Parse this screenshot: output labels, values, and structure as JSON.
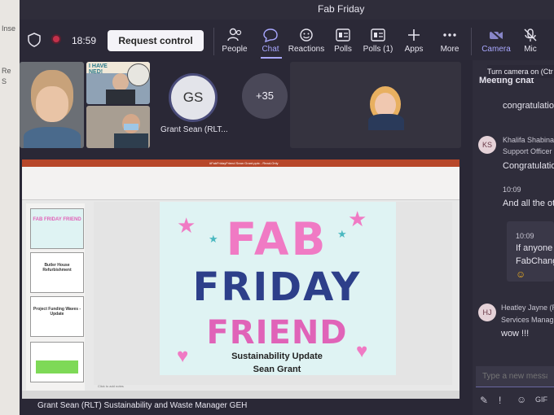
{
  "window": {
    "title": "Fab Friday"
  },
  "background_app": {
    "fragments": [
      "Inse",
      "Re",
      "S"
    ]
  },
  "toolbar": {
    "timer": "18:59",
    "request_control": "Request control",
    "buttons": [
      {
        "label": "People",
        "icon": "people-icon"
      },
      {
        "label": "Chat",
        "icon": "chat-icon"
      },
      {
        "label": "Reactions",
        "icon": "reactions-icon"
      },
      {
        "label": "Polls",
        "icon": "polls-icon"
      },
      {
        "label": "Polls (1)",
        "icon": "polls-icon"
      },
      {
        "label": "Apps",
        "icon": "plus-icon"
      },
      {
        "label": "More",
        "icon": "more-icon"
      },
      {
        "label": "Camera",
        "icon": "camera-off-icon"
      },
      {
        "label": "Mic",
        "icon": "mic-off-icon"
      }
    ],
    "tooltip": "Turn camera on (Ctr"
  },
  "participants": {
    "avatar_initials": "GS",
    "avatar_name": "Grant Sean (RLT...",
    "overflow_count": "+35",
    "tile_text": "I HAVE\nNED!"
  },
  "presentation": {
    "app_title": "#FabFridayFriend Sean Grant.pptx - Read-Only",
    "slide_line1": "FAB",
    "slide_line2": "FRIDAY",
    "slide_line3": "FRIEND",
    "slide_sub1": "Sustainability Update",
    "slide_sub2": "Sean Grant",
    "thumb_labels": [
      "FAB FRIDAY FRIEND",
      "Butler House Refurbishment",
      "Project Funding Waves - Update"
    ],
    "notes": "Click to add notes",
    "presenter": "Grant Sean (RLT) Sustainability and Waste Manager GEH"
  },
  "chat": {
    "header": "Meeting chat",
    "messages": [
      {
        "text": "congratulatio"
      },
      {
        "initials": "KS",
        "name": "Khalifa Shabina",
        "role": "Support Officer",
        "text": "Congratulation"
      },
      {
        "time": "10:09",
        "text": "And all the ot"
      },
      {
        "time": "10:09",
        "text": "If anyone",
        "text2": "FabChang"
      },
      {
        "initials": "HJ",
        "name": "Heatley Jayne (R",
        "role": "Services Manag",
        "text": "wow !!!"
      }
    ],
    "placeholder": "Type a new messag"
  },
  "colors": {
    "accent": "#a9a8ff",
    "recording": "#c4314b",
    "slide_pink": "#f07ac4",
    "slide_navy": "#2d3f8a"
  }
}
